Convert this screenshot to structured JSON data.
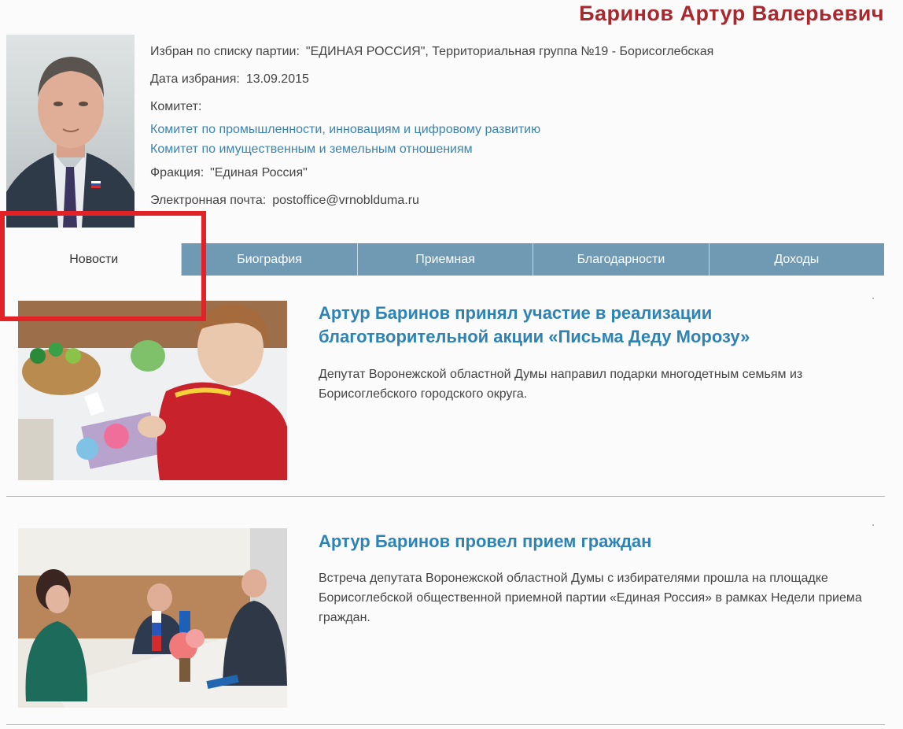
{
  "deputy": {
    "name": "Баринов Артур Валерьевич",
    "party_label": "Избран по списку партии:",
    "party_value": "\"ЕДИНАЯ РОССИЯ\", Территориальная группа №19 - Борисоглебская",
    "date_label": "Дата избрания:",
    "date_value": "13.09.2015",
    "committee_label": "Комитет:",
    "committees": [
      "Комитет по промышленности, инновациям и цифровому развитию",
      "Комитет по имущественным и земельным отношениям"
    ],
    "fraction_label": "Фракция:",
    "fraction_value": "\"Единая Россия\"",
    "email_label": "Электронная почта:",
    "email_value": "postoffice@vrnoblduma.ru"
  },
  "tabs": [
    {
      "label": "Новости",
      "active": true
    },
    {
      "label": "Биография",
      "active": false
    },
    {
      "label": "Приемная",
      "active": false
    },
    {
      "label": "Благодарности",
      "active": false
    },
    {
      "label": "Доходы",
      "active": false
    }
  ],
  "news": [
    {
      "title": "Артур Баринов принял участие в реализации благотворительной акции «Письма Деду Морозу»",
      "desc": "Депутат Воронежской областной Думы направил подарки  многодетным семьям из Борисоглебского городского округа."
    },
    {
      "title": "Артур Баринов провел прием граждан",
      "desc": "Встреча депутата Воронежской областной Думы с избирателями прошла на площадке Борисоглебской общественной приемной партии «Единая Россия» в рамках Недели приема граждан."
    }
  ],
  "colors": {
    "name": "#a8282e",
    "link": "#3a84b0",
    "tab_bg": "#7099b3",
    "highlight": "#e32228"
  }
}
